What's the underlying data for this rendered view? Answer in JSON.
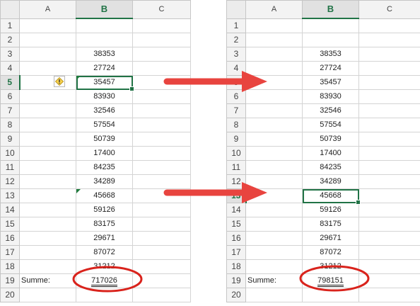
{
  "columns": [
    "A",
    "B",
    "C"
  ],
  "left": {
    "rows": [
      {
        "n": "1",
        "a": "",
        "b": ""
      },
      {
        "n": "2",
        "a": "",
        "b": ""
      },
      {
        "n": "3",
        "a": "",
        "b": "38353"
      },
      {
        "n": "4",
        "a": "",
        "b": "27724"
      },
      {
        "n": "5",
        "a": "",
        "b": "35457"
      },
      {
        "n": "6",
        "a": "",
        "b": "83930"
      },
      {
        "n": "7",
        "a": "",
        "b": "32546"
      },
      {
        "n": "8",
        "a": "",
        "b": "57554"
      },
      {
        "n": "9",
        "a": "",
        "b": "50739"
      },
      {
        "n": "10",
        "a": "",
        "b": "17400"
      },
      {
        "n": "11",
        "a": "",
        "b": "84235"
      },
      {
        "n": "12",
        "a": "",
        "b": "34289"
      },
      {
        "n": "13",
        "a": "",
        "b": "45668"
      },
      {
        "n": "14",
        "a": "",
        "b": "59126"
      },
      {
        "n": "15",
        "a": "",
        "b": "83175"
      },
      {
        "n": "16",
        "a": "",
        "b": "29671"
      },
      {
        "n": "17",
        "a": "",
        "b": "87072"
      },
      {
        "n": "18",
        "a": "",
        "b": "31212"
      },
      {
        "n": "19",
        "a": "Summe:",
        "b": "717026"
      },
      {
        "n": "20",
        "a": "",
        "b": ""
      }
    ],
    "active_row": "5",
    "warning_icon": "exclamation-diamond-icon"
  },
  "right": {
    "rows": [
      {
        "n": "1",
        "a": "",
        "b": ""
      },
      {
        "n": "2",
        "a": "",
        "b": ""
      },
      {
        "n": "3",
        "a": "",
        "b": "38353"
      },
      {
        "n": "4",
        "a": "",
        "b": "27724"
      },
      {
        "n": "5",
        "a": "",
        "b": "35457"
      },
      {
        "n": "6",
        "a": "",
        "b": "83930"
      },
      {
        "n": "7",
        "a": "",
        "b": "32546"
      },
      {
        "n": "8",
        "a": "",
        "b": "57554"
      },
      {
        "n": "9",
        "a": "",
        "b": "50739"
      },
      {
        "n": "10",
        "a": "",
        "b": "17400"
      },
      {
        "n": "11",
        "a": "",
        "b": "84235"
      },
      {
        "n": "12",
        "a": "",
        "b": "34289"
      },
      {
        "n": "13",
        "a": "",
        "b": "45668"
      },
      {
        "n": "14",
        "a": "",
        "b": "59126"
      },
      {
        "n": "15",
        "a": "",
        "b": "83175"
      },
      {
        "n": "16",
        "a": "",
        "b": "29671"
      },
      {
        "n": "17",
        "a": "",
        "b": "87072"
      },
      {
        "n": "18",
        "a": "",
        "b": "31212"
      },
      {
        "n": "19",
        "a": "Summe:",
        "b": "798151"
      },
      {
        "n": "20",
        "a": "",
        "b": ""
      }
    ],
    "active_row": "13"
  },
  "colors": {
    "excel_green": "#217346",
    "arrow_red": "#e8443f",
    "circle_red": "#d9231c"
  }
}
